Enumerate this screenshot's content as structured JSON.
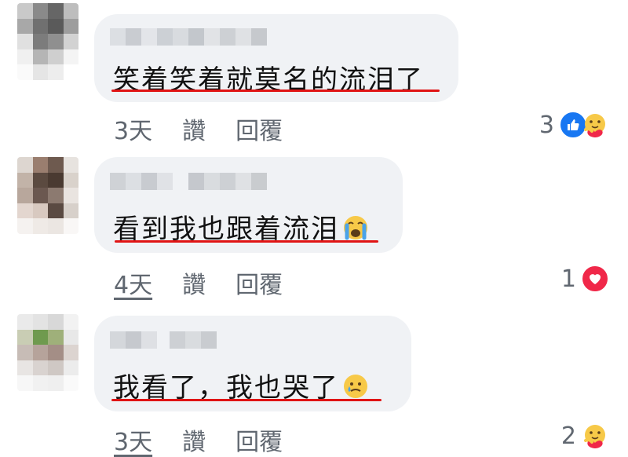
{
  "comments": [
    {
      "text": "笑着笑着就莫名的流泪了",
      "time": "3天",
      "like_label": "讚",
      "reply_label": "回覆",
      "reaction_count": "3",
      "reactions": [
        "like-icon",
        "care-icon"
      ],
      "avatar_colors": [
        "#c9c9c9",
        "#8a8a8a",
        "#666",
        "#bdbdbd",
        "#a8a8a8",
        "#707070",
        "#5a5a5a",
        "#9d9d9d",
        "#e0e0e0",
        "#7c7c7c",
        "#8f8f8f",
        "#d2d2d2",
        "#f0f0f0",
        "#b5b5b5",
        "#cfcfcf",
        "#f4f4f4",
        "#fafafa",
        "#e5e5e5",
        "#ededed",
        "#ffffff"
      ]
    },
    {
      "text": "看到我也跟着流泪",
      "time": "4天",
      "like_label": "讚",
      "reply_label": "回覆",
      "reaction_count": "1",
      "reactions": [
        "heart-icon"
      ],
      "avatar_colors": [
        "#ddd6d0",
        "#9a7e6f",
        "#6e5a4f",
        "#e7e3df",
        "#c2b3a8",
        "#5b4a40",
        "#4a3a31",
        "#d9d2cb",
        "#b8a79c",
        "#6b5850",
        "#8c7a70",
        "#e9e4e0",
        "#e3d6cf",
        "#d8c9c0",
        "#5a4a42",
        "#d7d0ca",
        "#f5f2f0",
        "#efeae6",
        "#ebe6e2",
        "#f9f7f6"
      ]
    },
    {
      "text": "我看了，我也哭了",
      "time": "3天",
      "like_label": "讚",
      "reply_label": "回覆",
      "reaction_count": "2",
      "reactions": [
        "care-icon"
      ],
      "avatar_colors": [
        "#eaeaea",
        "#e3e3e3",
        "#d8d8d8",
        "#f2f2f2",
        "#c9cdb4",
        "#6f9a4e",
        "#9fb07a",
        "#e8e8e8",
        "#c7bcb6",
        "#b6a39b",
        "#a48e86",
        "#dcd4d0",
        "#e8e5e3",
        "#d9d3d0",
        "#cfc8c4",
        "#ececec",
        "#f7f7f7",
        "#f1f1f1",
        "#efefef",
        "#fafafa"
      ]
    }
  ],
  "colors": {
    "underline": "#e01414",
    "bubble": "#f0f2f5",
    "meta_text": "#606770",
    "like": "#1877f2",
    "heart": "#f02849"
  }
}
